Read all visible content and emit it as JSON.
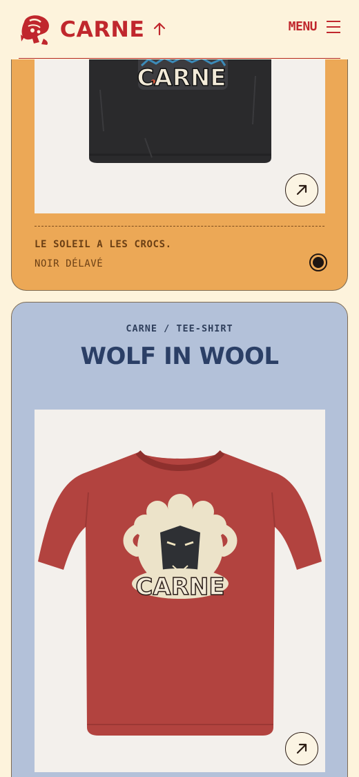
{
  "header": {
    "brand": "CARNE",
    "menu_label": "MENU",
    "logo_icon": "steak-mascot-icon",
    "up_icon": "arrow-up-icon",
    "menu_icon": "hamburger-icon"
  },
  "products": [
    {
      "name": "LE SOLEIL A LES CROCS.",
      "color": "NOIR DÉLAVÉ",
      "shirt_print": "CARNE",
      "shirt_color": "#2a2a2c",
      "card_color": "#eca856",
      "link_icon": "arrow-up-right-icon"
    },
    {
      "breadcrumb": "CARNE / TEE-SHIRT",
      "name": "WOLF IN WOOL",
      "shirt_print": "CARNE",
      "shirt_color": "#b2433f",
      "card_color": "#b3c1d9",
      "link_icon": "arrow-up-right-icon"
    }
  ],
  "colors": {
    "brand_red": "#c0272d",
    "background": "#fdf3dc",
    "navy": "#2b3f66"
  }
}
